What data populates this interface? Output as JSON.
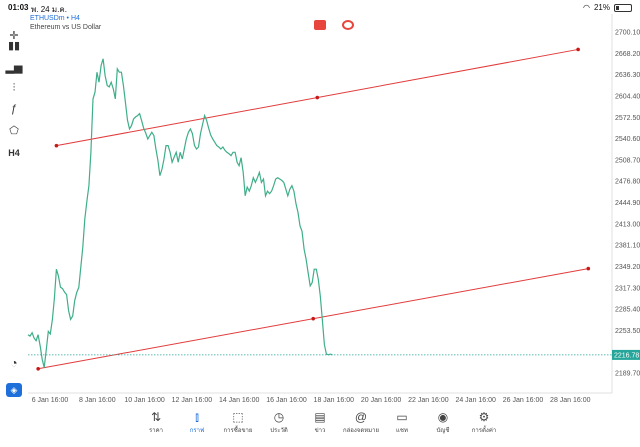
{
  "status": {
    "time": "01:03",
    "date": "พ. 24 ม.ค.",
    "battery": "21%"
  },
  "symbol": {
    "name": "ETHUSDm • H4",
    "desc": "Ethereum vs US Dollar"
  },
  "toolbar_icons": [
    "crosshair-icon",
    "candles-icon",
    "bars-icon",
    "indicators-icon",
    "function-icon",
    "objects-icon"
  ],
  "timeframe": "H4",
  "price_labels": [
    "2700.10",
    "2668.20",
    "2636.30",
    "2604.40",
    "2572.50",
    "2540.60",
    "2508.70",
    "2476.80",
    "2444.90",
    "2413.00",
    "2381.10",
    "2349.20",
    "2317.30",
    "2285.40",
    "2253.50",
    "2216.78",
    "2189.70"
  ],
  "current_price": "2216.78",
  "time_labels": [
    "6 Jan 16:00",
    "8 Jan 16:00",
    "10 Jan 16:00",
    "12 Jan 16:00",
    "14 Jan 16:00",
    "16 Jan 16:00",
    "18 Jan 16:00",
    "20 Jan 16:00",
    "22 Jan 16:00",
    "24 Jan 16:00",
    "26 Jan 16:00",
    "28 Jan 16:00"
  ],
  "colors": {
    "line": "#3fae8a",
    "trendline": "#e23b3b",
    "price_tag": "#26a69a",
    "accent": "#1e6fd9"
  },
  "nav": [
    {
      "label": "ราคา",
      "icon": "quotes-icon"
    },
    {
      "label": "กราฟ",
      "icon": "chart-icon",
      "active": true
    },
    {
      "label": "การซื้อขาย",
      "icon": "trade-icon"
    },
    {
      "label": "ประวัติ",
      "icon": "history-icon"
    },
    {
      "label": "ข่าว",
      "icon": "news-icon"
    },
    {
      "label": "กล่องจดหมาย",
      "icon": "mailbox-icon"
    },
    {
      "label": "แชท",
      "icon": "chat-icon"
    },
    {
      "label": "บัญชี",
      "icon": "account-icon"
    },
    {
      "label": "การตั้งค่า",
      "icon": "settings-icon"
    }
  ],
  "chart_data": {
    "type": "line",
    "x_unit": "H4 bars (index from first bar, 6 Jan 08:00 approx)",
    "series": [
      {
        "values": [
          2247,
          2245,
          2250,
          2242,
          2238,
          2247,
          2230,
          2210,
          2198,
          2225,
          2252,
          2248,
          2270,
          2302,
          2345,
          2335,
          2318,
          2316,
          2311,
          2307,
          2283,
          2270,
          2275,
          2298,
          2310,
          2318,
          2348,
          2378,
          2420,
          2447,
          2470,
          2520,
          2600,
          2610,
          2640,
          2625,
          2650,
          2660,
          2635,
          2620,
          2618,
          2625,
          2615,
          2600,
          2645,
          2640,
          2640,
          2620,
          2595,
          2568,
          2555,
          2560,
          2570,
          2573,
          2575,
          2578,
          2567,
          2556,
          2549,
          2540,
          2545,
          2550,
          2545,
          2525,
          2508,
          2485,
          2495,
          2510,
          2530,
          2530,
          2520,
          2505,
          2513,
          2520,
          2505,
          2520,
          2510,
          2525,
          2540,
          2550,
          2555,
          2548,
          2530,
          2525,
          2528,
          2548,
          2562,
          2575,
          2568,
          2556,
          2546,
          2540,
          2535,
          2530,
          2528,
          2525,
          2528,
          2523,
          2520,
          2518,
          2515,
          2520,
          2520,
          2505,
          2500,
          2512,
          2490,
          2455,
          2468,
          2462,
          2470,
          2482,
          2475,
          2482,
          2490,
          2475,
          2480,
          2455,
          2462,
          2458,
          2462,
          2470,
          2480,
          2482,
          2480,
          2478,
          2475,
          2465,
          2455,
          2465,
          2470,
          2462,
          2443,
          2430,
          2410,
          2402,
          2375,
          2360,
          2340,
          2320,
          2325,
          2345,
          2345,
          2330,
          2305,
          2270,
          2232,
          2218,
          2217,
          2218,
          2217
        ]
      }
    ],
    "trendlines": [
      {
        "start_bar": 14,
        "start_price": 2530,
        "end_bar": 271,
        "end_price": 2674
      },
      {
        "start_bar": 5,
        "start_price": 2196,
        "end_bar": 276,
        "end_price": 2346
      }
    ],
    "ylim": [
      2175,
      2715
    ],
    "grid": false
  }
}
